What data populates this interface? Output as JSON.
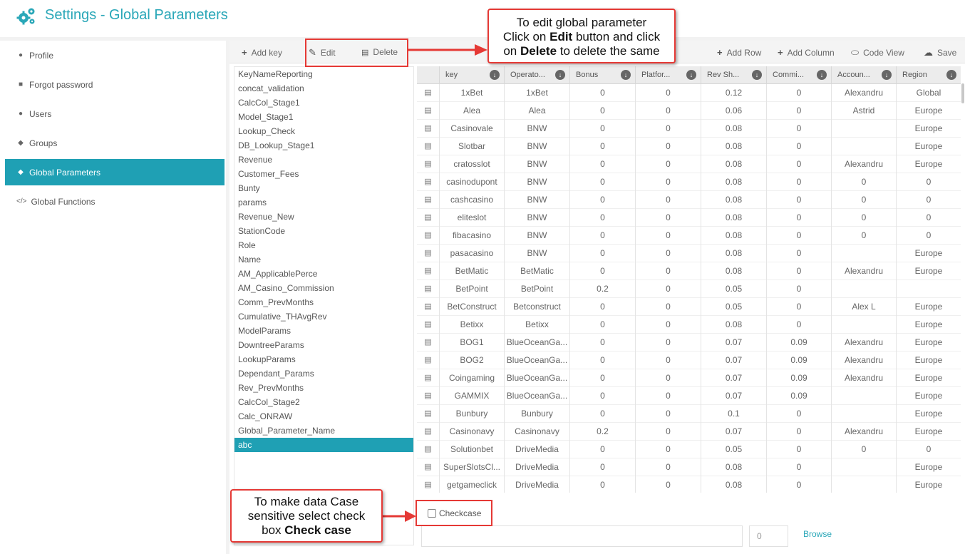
{
  "header": {
    "title": "Settings - Global Parameters"
  },
  "sidebar": {
    "items": [
      {
        "label": "Profile",
        "icon": "user-icon"
      },
      {
        "label": "Forgot password",
        "icon": "lock-icon"
      },
      {
        "label": "Users",
        "icon": "users-icon"
      },
      {
        "label": "Groups",
        "icon": "tags-icon"
      },
      {
        "label": "Global Parameters",
        "icon": "tag-icon",
        "active": true
      },
      {
        "label": "Global Functions",
        "icon": "code-icon"
      }
    ]
  },
  "toolbar": {
    "add_key": "Add key",
    "edit": "Edit",
    "delete": "Delete",
    "add_row": "Add Row",
    "add_column": "Add Column",
    "code_view": "Code View",
    "save": "Save"
  },
  "keys": [
    "KeyNameReporting",
    "concat_validation",
    "CalcCol_Stage1",
    "Model_Stage1",
    "Lookup_Check",
    "DB_Lookup_Stage1",
    "Revenue",
    "Customer_Fees",
    "Bunty",
    "params",
    "Revenue_New",
    "StationCode",
    "Role",
    "Name",
    "AM_ApplicablePerce",
    "AM_Casino_Commission",
    "Comm_PrevMonths",
    "Cumulative_THAvgRev",
    "ModelParams",
    "DowntreeParams",
    "LookupParams",
    "Dependant_Params",
    "Rev_PrevMonths",
    "CalcCol_Stage2",
    "Calc_ONRAW",
    "Global_Parameter_Name",
    "abc"
  ],
  "selected_key": "abc",
  "table": {
    "columns": [
      "key",
      "Operato...",
      "Bonus",
      "Platfor...",
      "Rev Sh...",
      "Commi...",
      "Accoun...",
      "Region"
    ],
    "rows": [
      [
        "1xBet",
        "1xBet",
        "0",
        "0",
        "0.12",
        "0",
        "Alexandru",
        "Global"
      ],
      [
        "Alea",
        "Alea",
        "0",
        "0",
        "0.06",
        "0",
        "Astrid",
        "Europe"
      ],
      [
        "Casinovale",
        "BNW",
        "0",
        "0",
        "0.08",
        "0",
        "",
        "Europe"
      ],
      [
        "Slotbar",
        "BNW",
        "0",
        "0",
        "0.08",
        "0",
        "",
        "Europe"
      ],
      [
        "cratosslot",
        "BNW",
        "0",
        "0",
        "0.08",
        "0",
        "Alexandru",
        "Europe"
      ],
      [
        "casinodupont",
        "BNW",
        "0",
        "0",
        "0.08",
        "0",
        "0",
        "0"
      ],
      [
        "cashcasino",
        "BNW",
        "0",
        "0",
        "0.08",
        "0",
        "0",
        "0"
      ],
      [
        "eliteslot",
        "BNW",
        "0",
        "0",
        "0.08",
        "0",
        "0",
        "0"
      ],
      [
        "fibacasino",
        "BNW",
        "0",
        "0",
        "0.08",
        "0",
        "0",
        "0"
      ],
      [
        "pasacasino",
        "BNW",
        "0",
        "0",
        "0.08",
        "0",
        "",
        "Europe"
      ],
      [
        "BetMatic",
        "BetMatic",
        "0",
        "0",
        "0.08",
        "0",
        "Alexandru",
        "Europe"
      ],
      [
        "BetPoint",
        "BetPoint",
        "0.2",
        "0",
        "0.05",
        "0",
        "",
        ""
      ],
      [
        "BetConstruct",
        "Betconstruct",
        "0",
        "0",
        "0.05",
        "0",
        "Alex L",
        "Europe"
      ],
      [
        "Betixx",
        "Betixx",
        "0",
        "0",
        "0.08",
        "0",
        "",
        "Europe"
      ],
      [
        "BOG1",
        "BlueOceanGa...",
        "0",
        "0",
        "0.07",
        "0.09",
        "Alexandru",
        "Europe"
      ],
      [
        "BOG2",
        "BlueOceanGa...",
        "0",
        "0",
        "0.07",
        "0.09",
        "Alexandru",
        "Europe"
      ],
      [
        "Coingaming",
        "BlueOceanGa...",
        "0",
        "0",
        "0.07",
        "0.09",
        "Alexandru",
        "Europe"
      ],
      [
        "GAMMIX",
        "BlueOceanGa...",
        "0",
        "0",
        "0.07",
        "0.09",
        "",
        "Europe"
      ],
      [
        "Bunbury",
        "Bunbury",
        "0",
        "0",
        "0.1",
        "0",
        "",
        "Europe"
      ],
      [
        "Casinonavy",
        "Casinonavy",
        "0.2",
        "0",
        "0.07",
        "0",
        "Alexandru",
        "Europe"
      ],
      [
        "Solutionbet",
        "DriveMedia",
        "0",
        "0",
        "0.05",
        "0",
        "0",
        "0"
      ],
      [
        "SuperSlotsCl...",
        "DriveMedia",
        "0",
        "0",
        "0.08",
        "0",
        "",
        "Europe"
      ],
      [
        "getgameclick",
        "DriveMedia",
        "0",
        "0",
        "0.08",
        "0",
        "",
        "Europe"
      ]
    ]
  },
  "checkcase_label": "Checkcase",
  "number_input_value": "0",
  "browse_label": "Browse",
  "callouts": {
    "edit_line1": "To edit global parameter",
    "edit_line2": "Click on",
    "edit_bold1": "Edit",
    "edit_line2b": "button and click",
    "edit_line3": "on",
    "edit_bold2": "Delete",
    "edit_line3b": "to delete the same",
    "case_line1": "To make data Case",
    "case_line2": "sensitive select check",
    "case_line3": "box",
    "case_bold": "Check case"
  },
  "colors": {
    "accent": "#1fa0b4",
    "title": "#2aa7b8",
    "callout_border": "#e53935"
  }
}
